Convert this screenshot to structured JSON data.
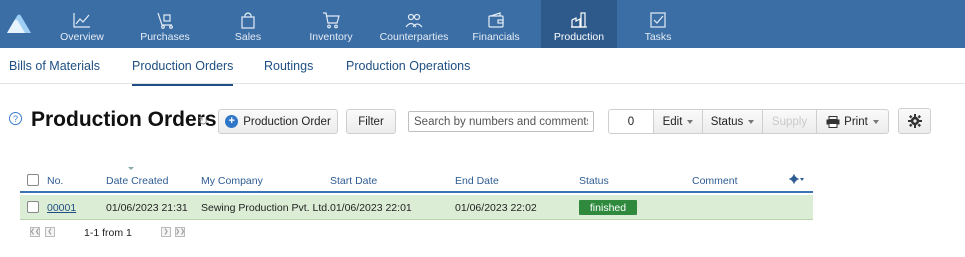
{
  "topnav": {
    "items": [
      {
        "label": "Overview",
        "icon": "chart-line-icon"
      },
      {
        "label": "Purchases",
        "icon": "hand-cart-icon"
      },
      {
        "label": "Sales",
        "icon": "shopping-bag-icon"
      },
      {
        "label": "Inventory",
        "icon": "cart-icon"
      },
      {
        "label": "Counterparties",
        "icon": "people-icon"
      },
      {
        "label": "Financials",
        "icon": "wallet-icon"
      },
      {
        "label": "Production",
        "icon": "factory-icon"
      },
      {
        "label": "Tasks",
        "icon": "checkbox-icon"
      }
    ],
    "active": "Production",
    "colors": {
      "bar": "#3b6ea5",
      "active": "#2d5a8b"
    }
  },
  "subnav": {
    "tabs": [
      {
        "label": "Bills of Materials"
      },
      {
        "label": "Production Orders"
      },
      {
        "label": "Routings"
      },
      {
        "label": "Production Operations"
      }
    ],
    "active": "Production Orders"
  },
  "header": {
    "title": "Production Orders",
    "help": "?",
    "add_button": "Production Order",
    "filter_button": "Filter",
    "search_placeholder": "Search by numbers and comments",
    "selected_count": "0",
    "edit_label": "Edit",
    "status_label": "Status",
    "supply_label": "Supply",
    "print_label": "Print"
  },
  "table": {
    "columns": [
      "No.",
      "Date Created",
      "My Company",
      "Start Date",
      "End Date",
      "Status",
      "Comment"
    ],
    "rows": [
      {
        "no": "00001",
        "date_created": "01/06/2023 21:31",
        "company": "Sewing Production Pvt. Ltd.",
        "start_date": "01/06/2023 22:01",
        "end_date": "01/06/2023 22:02",
        "status": "finished",
        "comment": ""
      }
    ],
    "colors": {
      "row_bg": "#dcedd6",
      "status_bg": "#2f8a3e"
    }
  },
  "pagination": {
    "info": "1-1 from 1"
  }
}
